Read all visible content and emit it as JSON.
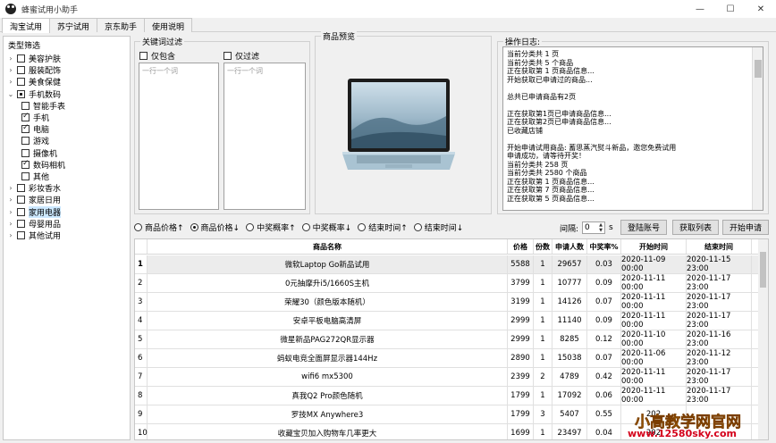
{
  "window": {
    "title": "蜂蜜试用小助手",
    "minimize": "—",
    "maximize": "☐",
    "close": "✕"
  },
  "tabs": [
    {
      "label": "淘宝试用",
      "active": true
    },
    {
      "label": "苏宁试用"
    },
    {
      "label": "京东助手"
    },
    {
      "label": "使用说明"
    }
  ],
  "tree": {
    "title": "类型筛选",
    "nodes": [
      {
        "label": "美容护肤",
        "level": 0,
        "expander": "›",
        "state": "none"
      },
      {
        "label": "服装配饰",
        "level": 0,
        "expander": "›",
        "state": "none"
      },
      {
        "label": "美食保健",
        "level": 0,
        "expander": "›",
        "state": "none"
      },
      {
        "label": "手机数码",
        "level": 0,
        "expander": "⌄",
        "state": "partial"
      },
      {
        "label": "智能手表",
        "level": 1,
        "state": "none"
      },
      {
        "label": "手机",
        "level": 1,
        "state": "checked"
      },
      {
        "label": "电脑",
        "level": 1,
        "state": "checked"
      },
      {
        "label": "游戏",
        "level": 1,
        "state": "none"
      },
      {
        "label": "摄像机",
        "level": 1,
        "state": "none"
      },
      {
        "label": "数码相机",
        "level": 1,
        "state": "checked"
      },
      {
        "label": "其他",
        "level": 1,
        "state": "none"
      },
      {
        "label": "彩妆香水",
        "level": 0,
        "expander": "›",
        "state": "none"
      },
      {
        "label": "家居日用",
        "level": 0,
        "expander": "›",
        "state": "none"
      },
      {
        "label": "家用电器",
        "level": 0,
        "expander": "›",
        "state": "none",
        "selected": true
      },
      {
        "label": "母婴用品",
        "level": 0,
        "expander": "›",
        "state": "none"
      },
      {
        "label": "其他试用",
        "level": 0,
        "expander": "›",
        "state": "none"
      }
    ]
  },
  "keyword_filter": {
    "title": "关键词过滤",
    "include_label": "仅包含",
    "exclude_label": "仅过滤",
    "include_placeholder": "一行一个词",
    "exclude_placeholder": "一行一个词"
  },
  "preview": {
    "title": "商品预览"
  },
  "log": {
    "title": "操作日志:",
    "lines": [
      "当前分类共 1 页",
      "当前分类共 5 个商品",
      "正在获取第 1 页商品信息...",
      "开始获取已申请过的商品...",
      "",
      "总共已申请商品有2页",
      "",
      "正在获取第1页已申请商品信息...",
      "正在获取第2页已申请商品信息...",
      "已收藏店铺",
      "",
      "开始申请试用商品: 蓄思蒸汽熨斗新品，邀您免费试用",
      "申请成功，请等待开奖！",
      "当前分类共 258 页",
      "当前分类共 2580 个商品",
      "正在获取第 1 页商品信息...",
      "正在获取第 7 页商品信息...",
      "正在获取第 5 页商品信息..."
    ]
  },
  "sort_options": [
    {
      "label": "商品价格↑",
      "selected": false
    },
    {
      "label": "商品价格↓",
      "selected": true
    },
    {
      "label": "中奖概率↑",
      "selected": false
    },
    {
      "label": "中奖概率↓",
      "selected": false
    },
    {
      "label": "结束时间↑",
      "selected": false
    },
    {
      "label": "结束时间↓",
      "selected": false
    }
  ],
  "interval": {
    "label": "间隔:",
    "value": "0",
    "unit": "s"
  },
  "buttons": {
    "login": "登陆账号",
    "fetch": "获取列表",
    "apply": "开始申请"
  },
  "table": {
    "columns": [
      "商品名称",
      "价格",
      "份数",
      "申请人数",
      "中奖率%",
      "开始时间",
      "结束时间"
    ],
    "rows": [
      [
        "1",
        "微软Laptop Go新品试用",
        "5588",
        "1",
        "29657",
        "0.03",
        "2020-11-09 00:00",
        "2020-11-15 23:00"
      ],
      [
        "2",
        "0元抽摩升i5/1660S主机",
        "3799",
        "1",
        "10777",
        "0.09",
        "2020-11-11 00:00",
        "2020-11-17 23:00"
      ],
      [
        "3",
        "荣耀30（颜色版本随机）",
        "3199",
        "1",
        "14126",
        "0.07",
        "2020-11-11 00:00",
        "2020-11-17 23:00"
      ],
      [
        "4",
        "安卓平板电脑高清屏",
        "2999",
        "1",
        "11140",
        "0.09",
        "2020-11-11 00:00",
        "2020-11-17 23:00"
      ],
      [
        "5",
        "微星新品PAG272QR显示器",
        "2999",
        "1",
        "8285",
        "0.12",
        "2020-11-10 00:00",
        "2020-11-16 23:00"
      ],
      [
        "6",
        "蚂蚁电竞全面屏显示器144Hz",
        "2890",
        "1",
        "15038",
        "0.07",
        "2020-11-06 00:00",
        "2020-11-12 23:00"
      ],
      [
        "7",
        "wifi6 mx5300",
        "2399",
        "2",
        "4789",
        "0.42",
        "2020-11-11 00:00",
        "2020-11-17 23:00"
      ],
      [
        "8",
        "真我Q2 Pro颜色随机",
        "1799",
        "1",
        "17092",
        "0.06",
        "2020-11-11 00:00",
        "2020-11-17 23:00"
      ],
      [
        "9",
        "罗技MX Anywhere3",
        "1799",
        "3",
        "5407",
        "0.55",
        "202",
        ""
      ],
      [
        "10",
        "收藏宝贝加入购物车几率更大",
        "1699",
        "1",
        "23497",
        "0.04",
        "202",
        ""
      ]
    ]
  },
  "watermark": {
    "line1": "小高教学网官网",
    "line2": "www.12580sky.com"
  }
}
